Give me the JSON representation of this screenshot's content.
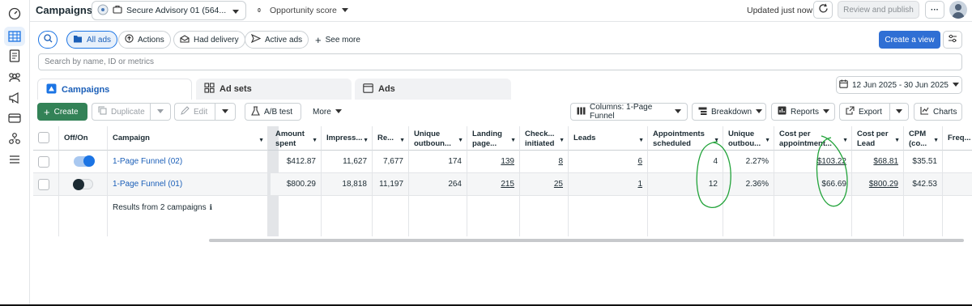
{
  "topbar": {
    "page_title": "Campaigns",
    "account_name": "Secure Advisory 01 (564...",
    "opportunity_badge": "0",
    "opportunity_label": "Opportunity score",
    "updated_text": "Updated just now",
    "review_publish": "Review and publish",
    "more_label": "···"
  },
  "filters": {
    "all_ads": "All ads",
    "actions": "Actions",
    "had_delivery": "Had delivery",
    "active_ads": "Active ads",
    "see_more": "See more",
    "create_view": "Create a view"
  },
  "search": {
    "placeholder": "Search by name, ID or metrics"
  },
  "tabs": {
    "campaigns": "Campaigns",
    "ad_sets": "Ad sets",
    "ads": "Ads"
  },
  "date_range": "12 Jun 2025 - 30 Jun 2025",
  "toolbar": {
    "create": "Create",
    "duplicate": "Duplicate",
    "edit": "Edit",
    "ab_test": "A/B test",
    "more": "More",
    "columns": "Columns: 1-Page Funnel",
    "breakdown": "Breakdown",
    "reports": "Reports",
    "export": "Export",
    "charts": "Charts"
  },
  "table": {
    "headers": {
      "offon": "Off/On",
      "campaign": "Campaign",
      "amount_spent": "Amount spent",
      "impressions": "Impress...",
      "reach": "Re...",
      "unique_outbound": "Unique outboun...",
      "landing": "Landing page...",
      "checkouts": "Check... initiated",
      "leads": "Leads",
      "appointments": "Appointments scheduled",
      "unique_outbound_ctr": "Unique outbou...",
      "cost_per_appt": "Cost per appointment...",
      "cost_per_lead": "Cost per Lead",
      "cpm": "CPM (co...",
      "freq": "Freq..."
    },
    "rows": [
      {
        "name": "1-Page Funnel (02)",
        "on": true,
        "amount_spent": "$412.87",
        "impressions": "11,627",
        "reach": "7,677",
        "unique_outbound": "174",
        "landing": "139",
        "checkouts": "8",
        "leads": "6",
        "appointments": "4",
        "unique_outbound_ctr": "2.27%",
        "cost_per_appt": "$103.22",
        "cost_per_lead": "$68.81",
        "cpm": "$35.51"
      },
      {
        "name": "1-Page Funnel (01)",
        "on": false,
        "amount_spent": "$800.29",
        "impressions": "18,818",
        "reach": "11,197",
        "unique_outbound": "264",
        "landing": "215",
        "checkouts": "25",
        "leads": "1",
        "appointments": "12",
        "unique_outbound_ctr": "2.36%",
        "cost_per_appt": "$66.69",
        "cost_per_lead": "$800.29",
        "cpm": "$42.53"
      }
    ],
    "results_text": "Results from 2 campaigns",
    "info_glyph": "ℹ"
  },
  "colors": {
    "accent": "#1b74e4",
    "create_green": "#338257",
    "annotation_green": "#22a33a"
  }
}
